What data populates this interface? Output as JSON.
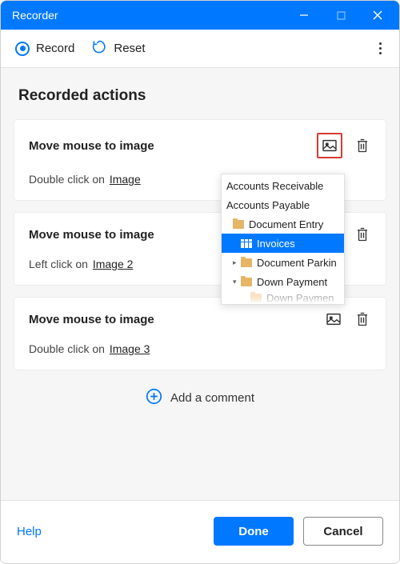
{
  "titlebar": {
    "title": "Recorder"
  },
  "toolbar": {
    "record": "Record",
    "reset": "Reset"
  },
  "section_title": "Recorded actions",
  "actions": [
    {
      "title": "Move mouse to image",
      "desc_prefix": "Double click on",
      "link": "Image"
    },
    {
      "title": "Move mouse to image",
      "desc_prefix": "Left click on",
      "link": "Image 2"
    },
    {
      "title": "Move mouse to image",
      "desc_prefix": "Double click on",
      "link": "Image 3"
    }
  ],
  "add_comment": "Add a comment",
  "bottom": {
    "help": "Help",
    "done": "Done",
    "cancel": "Cancel"
  },
  "popup": {
    "items": [
      {
        "label": "Accounts Receivable",
        "indent": 0,
        "icon": "none",
        "selected": false
      },
      {
        "label": "Accounts Payable",
        "indent": 0,
        "icon": "none",
        "selected": false
      },
      {
        "label": "Document Entry",
        "indent": 1,
        "icon": "folder",
        "selected": false,
        "expander": "▾",
        "hideExpander": true
      },
      {
        "label": "Invoices",
        "indent": 1,
        "icon": "grid",
        "selected": true,
        "expander": ""
      },
      {
        "label": "Document Parkin",
        "indent": 1,
        "icon": "folder",
        "selected": false,
        "expander": "▸"
      },
      {
        "label": "Down Payment",
        "indent": 1,
        "icon": "folder",
        "selected": false,
        "expander": "▾"
      },
      {
        "label": "Down Paymen",
        "indent": 2,
        "icon": "folder",
        "selected": false,
        "hideExpander": true,
        "faded": true
      }
    ]
  }
}
